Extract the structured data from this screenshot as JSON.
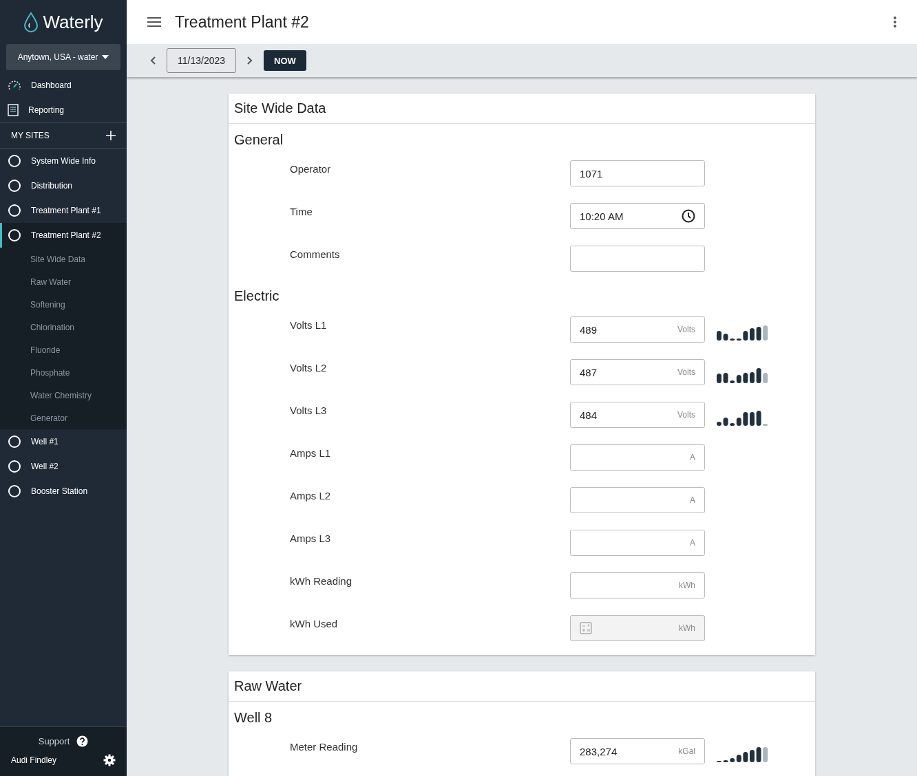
{
  "brand": {
    "name": "Waterly"
  },
  "location_selector": {
    "value": "Anytown, USA - water"
  },
  "nav": [
    {
      "label": "Dashboard",
      "kind": "dashboard"
    },
    {
      "label": "Reporting",
      "kind": "reporting"
    }
  ],
  "my_sites": {
    "title": "MY SITES",
    "sites": [
      {
        "label": "System Wide Info",
        "selected": false
      },
      {
        "label": "Distribution",
        "selected": false
      },
      {
        "label": "Treatment Plant #1",
        "selected": false
      },
      {
        "label": "Treatment Plant #2",
        "selected": true,
        "children": [
          {
            "label": "Site Wide Data"
          },
          {
            "label": "Raw Water"
          },
          {
            "label": "Softening"
          },
          {
            "label": "Chlorination"
          },
          {
            "label": "Fluoride"
          },
          {
            "label": "Phosphate"
          },
          {
            "label": "Water Chemistry"
          },
          {
            "label": "Generator"
          }
        ]
      },
      {
        "label": "Well #1",
        "selected": false
      },
      {
        "label": "Well #2",
        "selected": false
      },
      {
        "label": "Booster Station",
        "selected": false
      }
    ]
  },
  "footer": {
    "support": "Support",
    "user": "Audi Findley"
  },
  "header": {
    "title": "Treatment Plant #2"
  },
  "date_bar": {
    "date": "11/13/2023",
    "now_button": "NOW"
  },
  "sections": [
    {
      "title": "Site Wide Data",
      "groups": [
        {
          "title": "General",
          "fields": [
            {
              "label": "Operator",
              "kind": "text",
              "value": "1071",
              "trend": false,
              "disabled": false
            },
            {
              "label": "Time",
              "kind": "time",
              "value": "10:20 AM",
              "trend": false,
              "disabled": false
            },
            {
              "label": "Comments",
              "kind": "text",
              "trend": false,
              "disabled": false
            }
          ]
        },
        {
          "title": "Electric",
          "fields": [
            {
              "label": "Volts L1",
              "kind": "text",
              "value": "489",
              "unit": "Volts",
              "trend": true,
              "disabled": false
            },
            {
              "label": "Volts L2",
              "kind": "text",
              "value": "487",
              "unit": "Volts",
              "trend": true,
              "disabled": false
            },
            {
              "label": "Volts L3",
              "kind": "text",
              "value": "484",
              "unit": "Volts",
              "trend": true,
              "disabled": false
            },
            {
              "label": "Amps L1",
              "kind": "text",
              "unit": "A",
              "trend": false,
              "disabled": false
            },
            {
              "label": "Amps L2",
              "kind": "text",
              "unit": "A",
              "trend": false,
              "disabled": false
            },
            {
              "label": "Amps L3",
              "kind": "text",
              "unit": "A",
              "trend": false,
              "disabled": false
            },
            {
              "label": "kWh Reading",
              "kind": "text",
              "unit": "kWh",
              "trend": false,
              "disabled": false
            },
            {
              "label": "kWh Used",
              "kind": "calc",
              "unit": "kWh",
              "trend": false,
              "disabled": true
            }
          ]
        }
      ]
    },
    {
      "title": "Raw Water",
      "groups": [
        {
          "title": "Well 8",
          "fields": [
            {
              "label": "Meter Reading",
              "kind": "text",
              "value": "283,274",
              "unit": "kGal",
              "trend": true,
              "disabled": false
            }
          ]
        }
      ]
    }
  ]
}
